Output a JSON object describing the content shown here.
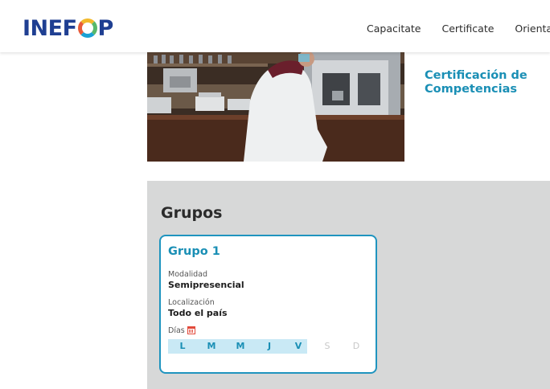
{
  "header": {
    "logo": {
      "text_before": "INEF",
      "text_after": "P"
    },
    "nav": [
      "Capacitate",
      "Certificate",
      "Orienta"
    ]
  },
  "hero": {
    "title": "Certificación de Competencias"
  },
  "groups_section": {
    "title": "Grupos",
    "cards": [
      {
        "title": "Grupo 1",
        "modalidad_label": "Modalidad",
        "modalidad_value": "Semipresencial",
        "localizacion_label": "Localización",
        "localizacion_value": "Todo el país",
        "dias_label": "Días",
        "days": [
          {
            "label": "L",
            "active": true
          },
          {
            "label": "M",
            "active": true
          },
          {
            "label": "M",
            "active": true
          },
          {
            "label": "J",
            "active": true
          },
          {
            "label": "V",
            "active": true
          },
          {
            "label": "S",
            "active": false
          },
          {
            "label": "D",
            "active": false
          }
        ]
      }
    ]
  },
  "colors": {
    "brand_blue": "#1f3f92",
    "accent_teal": "#1a8fb5",
    "days_highlight": "#c9e9f5",
    "section_bg": "#d7d8d8"
  }
}
